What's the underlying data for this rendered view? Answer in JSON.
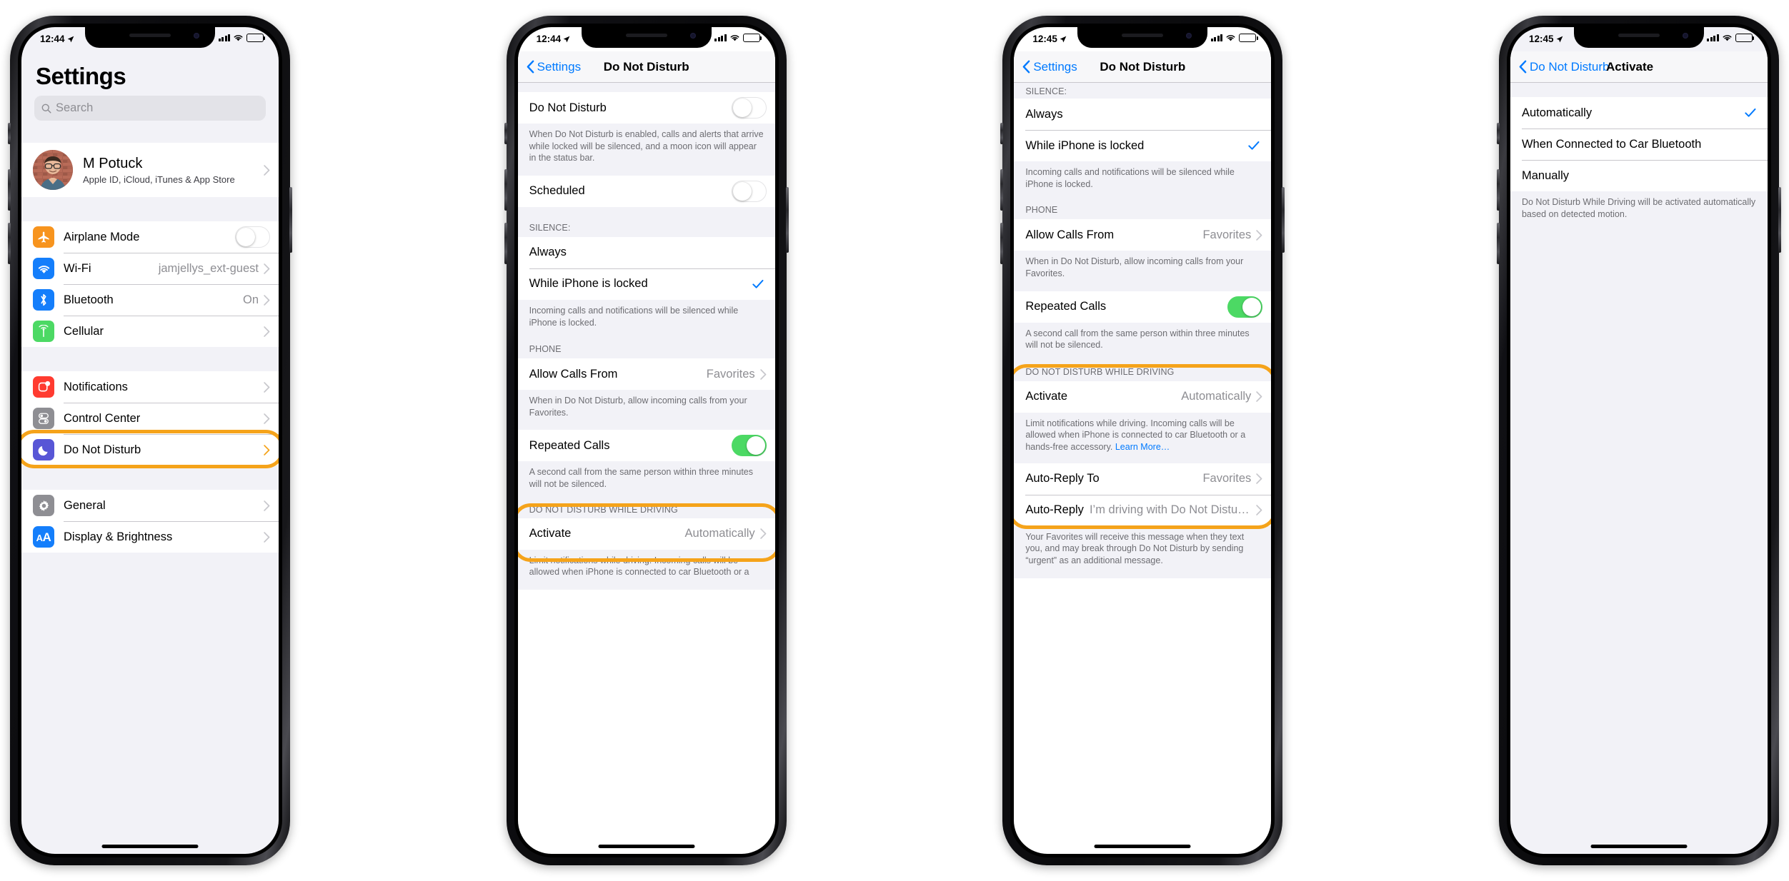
{
  "colors": {
    "highlight": "#f5a31a",
    "tint": "#007aff",
    "toggle_on": "#4cd964",
    "secondary_text": "#8e8e93"
  },
  "phones": [
    {
      "id": "phone-settings-root",
      "status": {
        "time": "12:44",
        "location_icon": "location-arrow-icon",
        "wifi": "wifi-icon",
        "battery": "battery-icon",
        "signal": "cellular-signal-icon"
      },
      "nav": {
        "type": "large-title",
        "title": "Settings"
      },
      "search": {
        "placeholder": "Search",
        "icon": "search-icon"
      },
      "profile": {
        "name": "M Potuck",
        "subtitle": "Apple ID, iCloud, iTunes & App Store",
        "avatar": "user-avatar"
      },
      "groups": [
        {
          "rows": [
            {
              "label": "Airplane Mode",
              "icon": "airplane-icon",
              "icon_color": "#f7941e",
              "accessory": "toggle",
              "toggle_on": false
            },
            {
              "label": "Wi-Fi",
              "icon": "wifi-icon",
              "icon_color": "#147efb",
              "value": "jamjellys_ext-guest",
              "accessory": "chevron"
            },
            {
              "label": "Bluetooth",
              "icon": "bluetooth-icon",
              "icon_color": "#147efb",
              "value": "On",
              "accessory": "chevron"
            },
            {
              "label": "Cellular",
              "icon": "cellular-icon",
              "icon_color": "#4cd964",
              "value": "",
              "accessory": "chevron"
            }
          ]
        },
        {
          "rows": [
            {
              "label": "Notifications",
              "icon": "notifications-icon",
              "icon_color": "#ff3b30",
              "accessory": "chevron"
            },
            {
              "label": "Control Center",
              "icon": "control-center-icon",
              "icon_color": "#8e8e93",
              "accessory": "chevron"
            },
            {
              "label": "Do Not Disturb",
              "icon": "moon-icon",
              "icon_color": "#5856d6",
              "accessory": "chevron",
              "highlighted": true
            }
          ]
        },
        {
          "rows": [
            {
              "label": "General",
              "icon": "gear-icon",
              "icon_color": "#8e8e93",
              "accessory": "chevron"
            },
            {
              "label": "Display & Brightness",
              "icon": "text-size-icon",
              "icon_color": "#147efb",
              "accessory": "chevron"
            }
          ]
        }
      ]
    },
    {
      "id": "phone-dnd-top",
      "status": {
        "time": "12:44"
      },
      "nav": {
        "type": "back",
        "back_label": "Settings",
        "title": "Do Not Disturb"
      },
      "rows_top": [
        {
          "label": "Do Not Disturb",
          "accessory": "toggle",
          "toggle_on": false
        }
      ],
      "footer_1": "When Do Not Disturb is enabled, calls and alerts that arrive while locked will be silenced, and a moon icon will appear in the status bar.",
      "rows_scheduled": [
        {
          "label": "Scheduled",
          "accessory": "toggle",
          "toggle_on": false
        }
      ],
      "silence_header": "SILENCE:",
      "silence_rows": [
        {
          "label": "Always",
          "checked": false
        },
        {
          "label": "While iPhone is locked",
          "checked": true
        }
      ],
      "silence_footer": "Incoming calls and notifications will be silenced while iPhone is locked.",
      "phone_header": "PHONE",
      "phone_rows": [
        {
          "label": "Allow Calls From",
          "value": "Favorites",
          "accessory": "chevron"
        }
      ],
      "phone_footer": "When in Do Not Disturb, allow incoming calls from your Favorites.",
      "repeated_rows": [
        {
          "label": "Repeated Calls",
          "accessory": "toggle",
          "toggle_on": true
        }
      ],
      "repeated_footer": "A second call from the same person within three minutes will not be silenced.",
      "driving_header": "DO NOT DISTURB WHILE DRIVING",
      "driving_rows": [
        {
          "label": "Activate",
          "value": "Automatically",
          "accessory": "chevron"
        }
      ],
      "driving_footer": "Limit notifications while driving. Incoming calls will be allowed when iPhone is connected to car Bluetooth or a"
    },
    {
      "id": "phone-dnd-bottom",
      "status": {
        "time": "12:45"
      },
      "nav": {
        "type": "back",
        "back_label": "Settings",
        "title": "Do Not Disturb"
      },
      "silence_header": "SILENCE:",
      "silence_rows": [
        {
          "label": "Always",
          "checked": false
        },
        {
          "label": "While iPhone is locked",
          "checked": true
        }
      ],
      "silence_footer": "Incoming calls and notifications will be silenced while iPhone is locked.",
      "phone_header": "PHONE",
      "phone_rows": [
        {
          "label": "Allow Calls From",
          "value": "Favorites",
          "accessory": "chevron"
        }
      ],
      "phone_footer": "When in Do Not Disturb, allow incoming calls from your Favorites.",
      "repeated_rows": [
        {
          "label": "Repeated Calls",
          "accessory": "toggle",
          "toggle_on": true
        }
      ],
      "repeated_footer": "A second call from the same person within three minutes will not be silenced.",
      "driving_header": "DO NOT DISTURB WHILE DRIVING",
      "driving_rows": [
        {
          "label": "Activate",
          "value": "Automatically",
          "accessory": "chevron"
        }
      ],
      "driving_footer_pre": "Limit notifications while driving. Incoming calls will be allowed when iPhone is connected to car Bluetooth or a hands-free accessory. ",
      "driving_footer_link": "Learn More…",
      "autoreply_rows": [
        {
          "label": "Auto-Reply To",
          "value": "Favorites",
          "accessory": "chevron"
        },
        {
          "label": "Auto-Reply",
          "value": "I’m driving with Do Not Disturb W…",
          "accessory": "chevron"
        }
      ],
      "autoreply_footer": "Your Favorites will receive this message when they text you, and may break through Do Not Disturb by sending “urgent” as an additional message."
    },
    {
      "id": "phone-activate",
      "status": {
        "time": "12:45"
      },
      "nav": {
        "type": "back",
        "back_label": "Do Not Disturb",
        "title": "Activate"
      },
      "options": [
        {
          "label": "Automatically",
          "checked": true
        },
        {
          "label": "When Connected to Car Bluetooth",
          "checked": false
        },
        {
          "label": "Manually",
          "checked": false
        }
      ],
      "footer": "Do Not Disturb While Driving will be activated automatically based on detected motion."
    }
  ]
}
